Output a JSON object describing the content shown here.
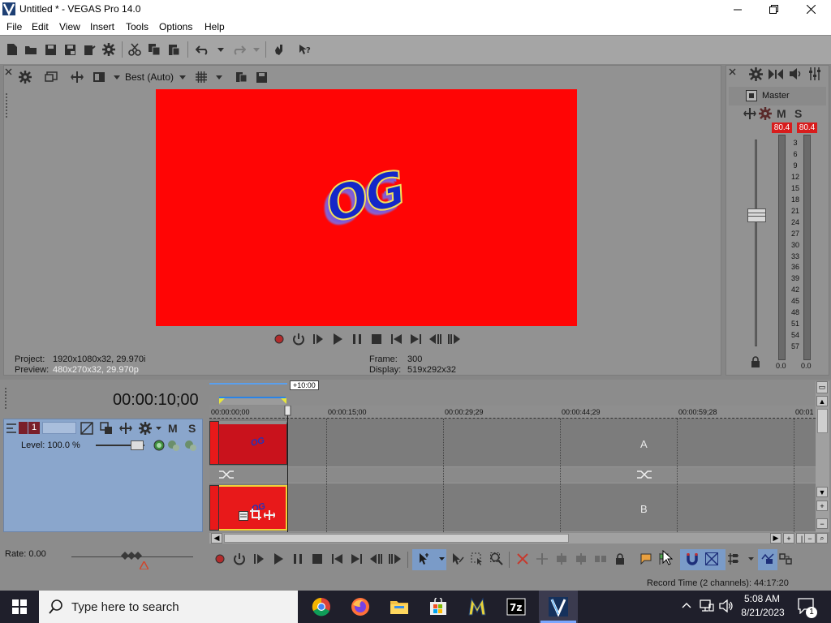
{
  "window": {
    "title": "Untitled * - VEGAS Pro 14.0",
    "minimize_icon": "minimize-icon",
    "maximize_icon": "restore-icon",
    "close_icon": "close-icon"
  },
  "menu": [
    "File",
    "Edit",
    "View",
    "Insert",
    "Tools",
    "Options",
    "Help"
  ],
  "preview": {
    "quality": "Best (Auto)",
    "frame_text": "OG",
    "frame_color": "#ff0505",
    "project_label": "Project:",
    "project_value": "1920x1080x32, 29.970i",
    "preview_label": "Preview:",
    "preview_value": "480x270x32, 29.970p",
    "frame_label": "Frame:",
    "frame_value": "300",
    "display_label": "Display:",
    "display_value": "519x292x32"
  },
  "master": {
    "label": "Master",
    "mute": "M",
    "solo": "S",
    "peak_left": "80.4",
    "peak_right": "80.4",
    "db_marks": [
      "3",
      "6",
      "9",
      "12",
      "15",
      "18",
      "21",
      "24",
      "27",
      "30",
      "33",
      "36",
      "39",
      "42",
      "45",
      "48",
      "51",
      "54",
      "57"
    ],
    "foot_left": "0.0",
    "foot_right": "0.0",
    "peak_color": "#d81c1c"
  },
  "timeline": {
    "time": "00:00:10;00",
    "marker_flag": "+10:00",
    "ruler": [
      "00:00:00;00",
      "00:00:15;00",
      "00:00:29;29",
      "00:00:44;29",
      "00:00:59;28",
      "00:01"
    ],
    "lane_a": "A",
    "lane_b": "B",
    "clip_text": "OG"
  },
  "track": {
    "number": "1",
    "mute": "M",
    "solo": "S",
    "level": "Level: 100.0 %"
  },
  "transport": {
    "rate": "Rate: 0.00"
  },
  "status": {
    "record_time": "Record Time (2 channels): 44:17:20"
  },
  "taskbar": {
    "search_placeholder": "Type here to search",
    "apps": [
      "chrome-icon",
      "firefox-icon",
      "file-explorer-icon",
      "microsoft-store-icon",
      "vegas-movie-studio-icon",
      "7zip-icon",
      "vegas-pro-icon"
    ],
    "time": "5:08 AM",
    "date": "8/21/2023",
    "notification_count": "1"
  },
  "colors": {
    "accent": "#2a84e8",
    "track_header": "#8aa6cc"
  }
}
